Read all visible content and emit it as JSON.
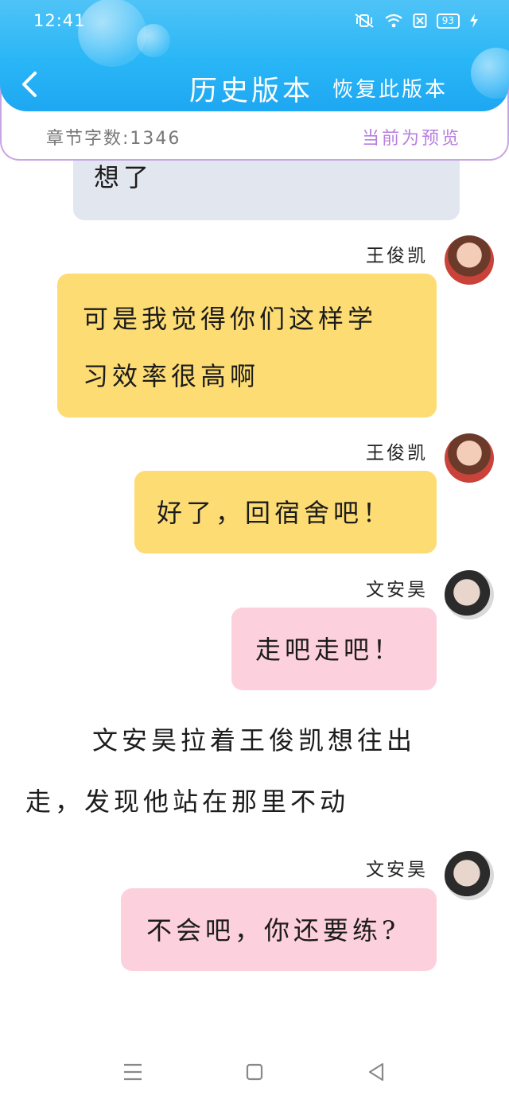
{
  "status_bar": {
    "time": "12:41",
    "battery": "93"
  },
  "header": {
    "title": "历史版本",
    "restore_label": "恢复此版本"
  },
  "info_bar": {
    "word_count": "章节字数:1346",
    "preview_label": "当前为预览"
  },
  "messages": [
    {
      "speaker": "",
      "line1": "想了",
      "line2": "",
      "color": "gray"
    },
    {
      "speaker": "王俊凯",
      "line1": "可是我觉得你们这样学",
      "line2": "习效率很高啊",
      "color": "yellow"
    },
    {
      "speaker": "王俊凯",
      "line1": "好了，回宿舍吧！",
      "line2": "",
      "color": "yellow"
    },
    {
      "speaker": "文安昊",
      "line1": "走吧走吧！",
      "line2": "",
      "color": "pink"
    },
    {
      "speaker": "文安昊",
      "line1": "不会吧，你还要练?",
      "line2": "",
      "color": "pink"
    }
  ],
  "narration": {
    "line1": "文安昊拉着王俊凯想往出",
    "line2": "走，发现他站在那里不动"
  },
  "nav": {
    "icons": [
      "menu-icon",
      "home-icon",
      "back-triangle-icon"
    ]
  },
  "colors": {
    "header": "#29b6f6",
    "accent_purple": "#b77ee0",
    "bubble_yellow": "#fddc74",
    "bubble_pink": "#fdd0dd",
    "bubble_gray": "#e2e6ee"
  }
}
